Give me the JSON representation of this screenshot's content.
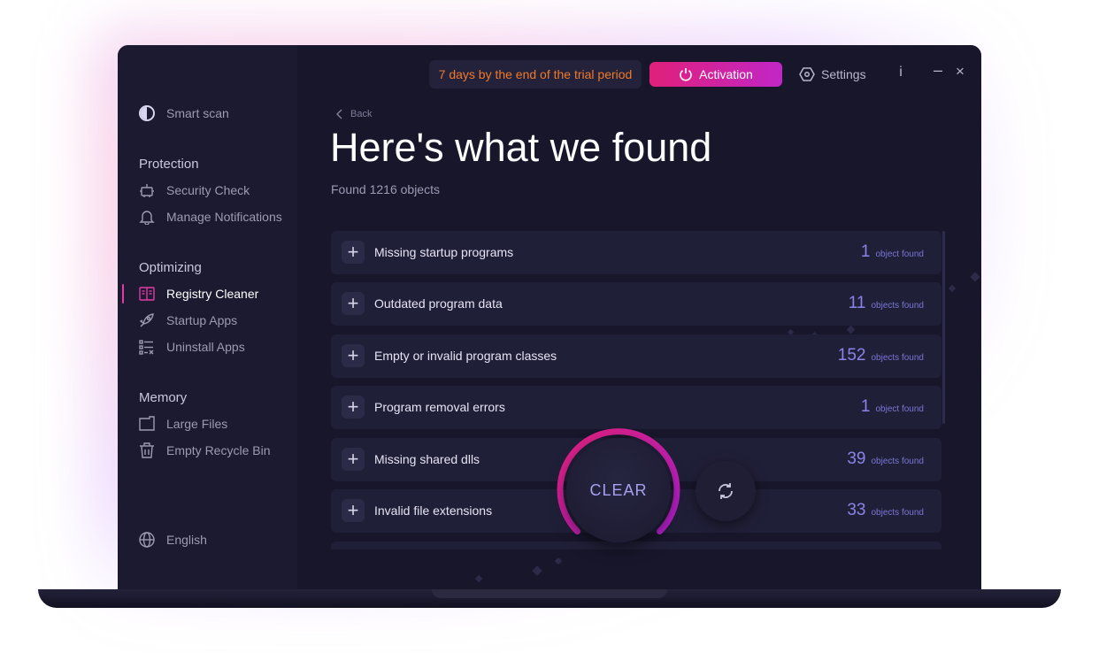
{
  "sidebar": {
    "smart_scan": "Smart scan",
    "sections": {
      "protection": "Protection",
      "optimizing": "Optimizing",
      "memory": "Memory"
    },
    "items": {
      "security_check": "Security Check",
      "manage_notifications": "Manage Notifications",
      "registry_cleaner": "Registry Cleaner",
      "startup_apps": "Startup Apps",
      "uninstall_apps": "Uninstall Apps",
      "large_files": "Large Files",
      "empty_recycle_bin": "Empty Recycle Bin"
    },
    "active_item": "registry_cleaner",
    "language": "English"
  },
  "topbar": {
    "trial_text": "7 days by the end of the trial period",
    "activation_label": "Activation",
    "settings_label": "Settings",
    "info_label": "i",
    "minimize_label": "–",
    "close_label": "×"
  },
  "main": {
    "back_label": "Back",
    "title": "Here's what we found",
    "found_text": "Found 1216 objects",
    "results": [
      {
        "label": "Missing startup programs",
        "count": "1",
        "unit": "object found"
      },
      {
        "label": "Outdated program data",
        "count": "11",
        "unit": "objects found"
      },
      {
        "label": "Empty or invalid program classes",
        "count": "152",
        "unit": "objects found"
      },
      {
        "label": "Program removal errors",
        "count": "1",
        "unit": "object found"
      },
      {
        "label": "Missing shared dlls",
        "count": "39",
        "unit": "objects found"
      },
      {
        "label": "Invalid file extensions",
        "count": "33",
        "unit": "objects found"
      }
    ],
    "clear_label": "CLEAR",
    "plus_glyph": "+"
  },
  "colors": {
    "accent_pink": "#e0207a",
    "accent_purple": "#c126c6",
    "trial_orange": "#f07a2b",
    "count_violet": "#8a84ea",
    "background": "#151428"
  },
  "icons": {
    "smart_scan": "smart-scan-icon",
    "security_check": "robot-icon",
    "manage_notifications": "bell-icon",
    "registry_cleaner": "registry-icon",
    "startup_apps": "rocket-icon",
    "uninstall_apps": "uninstall-list-icon",
    "large_files": "folder-icon",
    "empty_recycle_bin": "trash-icon",
    "language": "globe-icon",
    "activation": "power-icon",
    "settings": "gear-icon",
    "refresh": "refresh-icon"
  }
}
